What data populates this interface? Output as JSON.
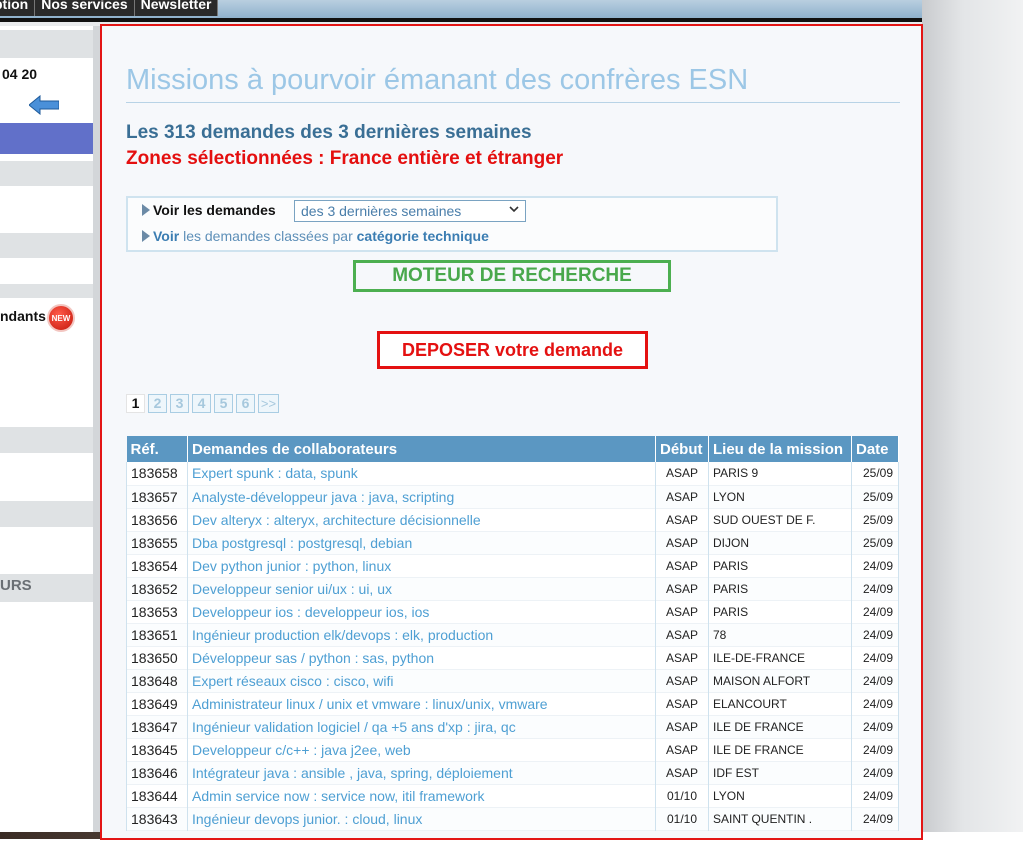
{
  "nav": {
    "tabs": [
      "ption",
      "Nos services",
      "Newsletter"
    ]
  },
  "sidebar": {
    "date_fragment": "04 20",
    "dants_fragment": "ndants",
    "new_badge": "NEW",
    "urs_fragment": "URS"
  },
  "main": {
    "title": "Missions à pourvoir émanant des confrères ESN",
    "count_line": "Les 313 demandes des 3 dernières semaines",
    "zones_line": "Zones sélectionnées : France entière et étranger",
    "filter": {
      "label": "Voir les demandes",
      "selected_period": "des 3 dernières semaines",
      "link_voir": "Voir",
      "link_middle": " les demandes classées par ",
      "link_category": "catégorie technique"
    },
    "search_button": "MOTEUR DE RECHERCHE",
    "depose_button_strong": "DEPOSER",
    "depose_button_rest": " votre demande",
    "pager": [
      "1",
      "2",
      "3",
      "4",
      "5",
      "6",
      ">>"
    ],
    "table": {
      "headers": [
        "Réf.",
        "Demandes de collaborateurs",
        "Début",
        "Lieu de la mission",
        "Date"
      ],
      "rows": [
        {
          "ref": "183658",
          "title": "Expert spunk : data, spunk",
          "debut": "ASAP",
          "lieu": "PARIS 9",
          "date": "25/09"
        },
        {
          "ref": "183657",
          "title": "Analyste-développeur java : java, scripting",
          "debut": "ASAP",
          "lieu": "LYON",
          "date": "25/09"
        },
        {
          "ref": "183656",
          "title": "Dev alteryx : alteryx, architecture décisionnelle",
          "debut": "ASAP",
          "lieu": "SUD OUEST DE F.",
          "date": "25/09"
        },
        {
          "ref": "183655",
          "title": "Dba postgresql : postgresql, debian",
          "debut": "ASAP",
          "lieu": "DIJON",
          "date": "25/09"
        },
        {
          "ref": "183654",
          "title": "Dev python junior : python, linux",
          "debut": "ASAP",
          "lieu": "PARIS",
          "date": "24/09"
        },
        {
          "ref": "183652",
          "title": "Developpeur senior ui/ux : ui, ux",
          "debut": "ASAP",
          "lieu": "PARIS",
          "date": "24/09"
        },
        {
          "ref": "183653",
          "title": "Developpeur ios : developpeur ios, ios",
          "debut": "ASAP",
          "lieu": "PARIS",
          "date": "24/09"
        },
        {
          "ref": "183651",
          "title": "Ingénieur production elk/devops : elk, production",
          "debut": "ASAP",
          "lieu": "78",
          "date": "24/09"
        },
        {
          "ref": "183650",
          "title": "Développeur sas / python : sas, python",
          "debut": "ASAP",
          "lieu": "ILE-DE-FRANCE",
          "date": "24/09"
        },
        {
          "ref": "183648",
          "title": "Expert réseaux cisco : cisco, wifi",
          "debut": "ASAP",
          "lieu": "MAISON ALFORT",
          "date": "24/09"
        },
        {
          "ref": "183649",
          "title": "Administrateur linux / unix et vmware : linux/unix, vmware",
          "debut": "ASAP",
          "lieu": "ELANCOURT",
          "date": "24/09"
        },
        {
          "ref": "183647",
          "title": "Ingénieur validation logiciel / qa +5 ans d'xp : jira, qc",
          "debut": "ASAP",
          "lieu": "ILE DE FRANCE",
          "date": "24/09"
        },
        {
          "ref": "183645",
          "title": "Developpeur c/c++ : java j2ee, web",
          "debut": "ASAP",
          "lieu": "ILE DE FRANCE",
          "date": "24/09"
        },
        {
          "ref": "183646",
          "title": "Intégrateur java : ansible , java, spring, déploiement",
          "debut": "ASAP",
          "lieu": "IDF EST",
          "date": "24/09"
        },
        {
          "ref": "183644",
          "title": "Admin service now : service now, itil framework",
          "debut": "01/10",
          "lieu": "LYON",
          "date": "24/09"
        },
        {
          "ref": "183643",
          "title": "Ingénieur devops junior. : cloud, linux",
          "debut": "01/10",
          "lieu": "SAINT QUENTIN .",
          "date": "24/09"
        }
      ]
    }
  }
}
